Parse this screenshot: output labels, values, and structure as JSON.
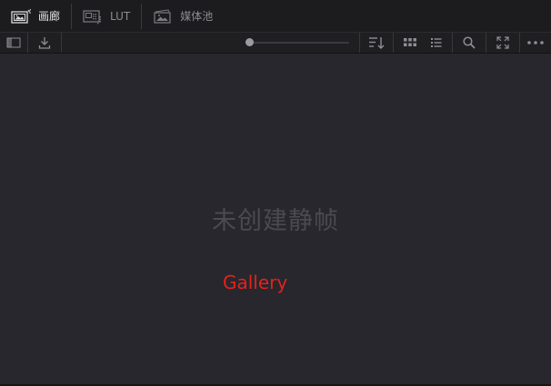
{
  "tabs": [
    {
      "label": "画廊",
      "icon": "gallery-icon",
      "active": true
    },
    {
      "label": "LUT",
      "icon": "lut-icon",
      "active": false
    },
    {
      "label": "媒体池",
      "icon": "media-pool-icon",
      "active": false
    }
  ],
  "toolbar": {
    "left_icons": [
      "sidebar-toggle-icon",
      "download-icon"
    ],
    "zoom_level": 0,
    "right_icons": [
      "sort-icon",
      "grid-view-icon",
      "list-view-icon",
      "search-icon",
      "expand-icon",
      "more-options-icon"
    ]
  },
  "content": {
    "empty_message": "未创建静帧",
    "annotation": "Gallery",
    "annotation_color": "#e5211c"
  },
  "colors": {
    "background": "#28272d",
    "tabbar": "#1c1c1f",
    "toolbar": "#1f1f22",
    "active_text": "#e6e6e9",
    "inactive_text": "#8b8b90"
  }
}
